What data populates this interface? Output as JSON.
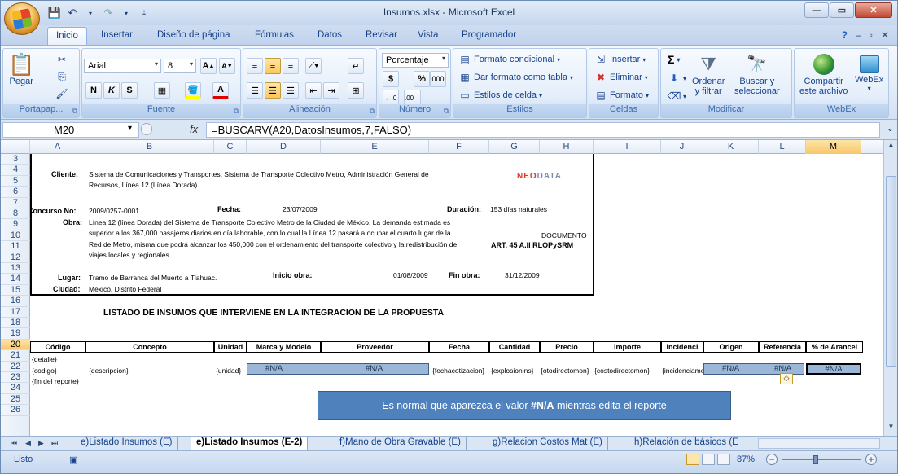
{
  "window": {
    "title": "Insumos.xlsx - Microsoft Excel"
  },
  "tabs": [
    "Inicio",
    "Insertar",
    "Diseño de página",
    "Fórmulas",
    "Datos",
    "Revisar",
    "Vista",
    "Programador"
  ],
  "ribbon": {
    "portapapeles": {
      "pegar": "Pegar",
      "label": "Portapap..."
    },
    "fuente": {
      "font": "Arial",
      "size": "8",
      "label": "Fuente"
    },
    "alineacion": {
      "label": "Alineación"
    },
    "numero": {
      "format": "Porcentaje",
      "currency": "$",
      "percent": "%",
      "thousands": "000",
      "label": "Número"
    },
    "estilos": {
      "cond": "Formato condicional",
      "tabla": "Dar formato como tabla",
      "celda": "Estilos de celda",
      "label": "Estilos"
    },
    "celdas": {
      "insertar": "Insertar",
      "eliminar": "Eliminar",
      "formato": "Formato",
      "label": "Celdas"
    },
    "modificar": {
      "sigma": "Σ",
      "ordenar1": "Ordenar",
      "ordenar2": "y filtrar",
      "buscar1": "Buscar y",
      "buscar2": "seleccionar",
      "label": "Modificar"
    },
    "webex": {
      "compartir1": "Compartir",
      "compartir2": "este archivo",
      "webex": "WebEx",
      "label": "WebEx"
    }
  },
  "formula_bar": {
    "cell": "M20",
    "formula": "=BUSCARV(A20,DatosInsumos,7,FALSO)"
  },
  "columns": [
    "A",
    "B",
    "C",
    "D",
    "E",
    "F",
    "G",
    "H",
    "I",
    "J",
    "K",
    "L",
    "M"
  ],
  "rows": [
    "3",
    "4",
    "5",
    "6",
    "7",
    "8",
    "9",
    "10",
    "11",
    "12",
    "13",
    "14",
    "15",
    "16",
    "17",
    "18",
    "19",
    "20",
    "21",
    "22",
    "23",
    "24",
    "25",
    "26"
  ],
  "doc": {
    "cliente_lbl": "Cliente:",
    "cliente1": "Sistema de Comunicaciones y Transportes, Sistema de Transporte Colectivo Metro, Administración General de",
    "cliente2": "Recursos, Línea 12 (Línea Dorada)",
    "concurso_lbl": "Concurso No:",
    "concurso": "2009/0257-0001",
    "fecha_lbl": "Fecha:",
    "fecha": "23/07/2009",
    "duracion_lbl": "Duración:",
    "duracion": "153 días naturales",
    "obra_lbl": "Obra:",
    "obra1": "Línea 12 (línea Dorada) del Sistema de Transporte Colectivo Metro de la Ciudad de México. La demanda estimada es",
    "obra2": "superior a los 367,000 pasajeros diarios en día laborable, con lo cual la Línea 12 pasará a ocupar el cuarto lugar de la",
    "obra3": "Red de Metro, misma que podrá alcanzar los 450,000 con el ordenamiento del transporte colectivo y la redistribución de",
    "obra4": "viajes locales y regionales.",
    "documento": "DOCUMENTO",
    "art": "ART. 45 A.II RLOPySRM",
    "lugar_lbl": "Lugar:",
    "lugar": "Tramo de Barranca del Muerto a Tlahuac.",
    "inicio_lbl": "Inicio obra:",
    "inicio": "01/08/2009",
    "fin_lbl": "Fin obra:",
    "fin": "31/12/2009",
    "ciudad_lbl": "Ciudad:",
    "ciudad": "México, Distrito Federal",
    "logo_a": "NEO",
    "logo_b": "DATA"
  },
  "listado_title": "LISTADO DE INSUMOS QUE INTERVIENE EN LA INTEGRACION DE LA PROPUESTA",
  "table_headers": [
    "Código",
    "Concepto",
    "Unidad",
    "Marca y Modelo",
    "Proveedor",
    "Fecha",
    "Cantidad",
    "Precio",
    "Importe",
    "Incidenci",
    "Origen",
    "Referencia",
    "% de Arancel"
  ],
  "template_rows": {
    "detalle": "{detalle}",
    "codigo": "{codigo}",
    "descripcion": "{descripcion}",
    "unidad": "{unidad}",
    "na": "#N/A",
    "fecha": "{fechacotizacion}",
    "cantidad": "{explosionins}",
    "precio": "{otodirectomon}",
    "importe": "{costodirectomon}",
    "incid": "{incidenciamon}",
    "fin": "{fin del reporte}"
  },
  "callout": {
    "pre": "Es normal que aparezca el valor ",
    "bold": "#N/A",
    "post": " mientras edita el reporte"
  },
  "sheet_tabs": [
    "e)Listado Insumos (E)",
    "e)Listado Insumos (E-2)",
    "f)Mano de Obra Gravable (E)",
    "g)Relacion Costos Mat (E)",
    "h)Relación de básicos (E"
  ],
  "status": {
    "text": "Listo",
    "zoom": "87%"
  }
}
